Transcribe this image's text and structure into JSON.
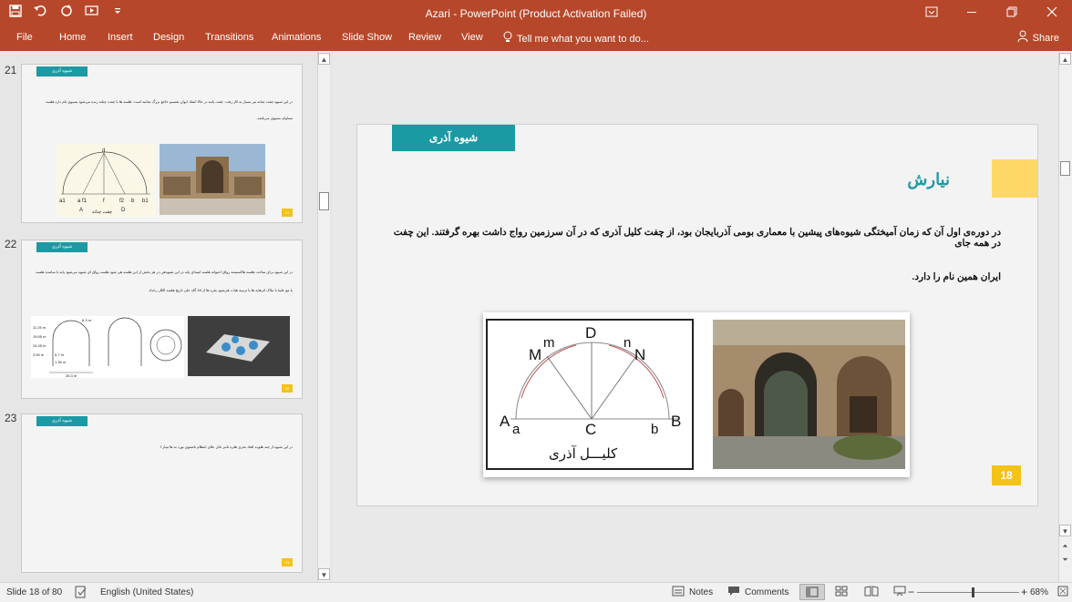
{
  "app": {
    "title": "Azari - PowerPoint (Product Activation Failed)",
    "accent": "#b7472a"
  },
  "qat": [
    "save-icon",
    "undo-icon",
    "redo-icon",
    "from-beginning-icon",
    "customize-icon"
  ],
  "window_controls": [
    "ribbon-display-icon",
    "minimize-icon",
    "maximize-icon",
    "close-icon"
  ],
  "ribbon": {
    "tabs": [
      "File",
      "Home",
      "Insert",
      "Design",
      "Transitions",
      "Animations",
      "Slide Show",
      "Review",
      "View"
    ],
    "tell_me": "Tell me what you want to do...",
    "share": "Share"
  },
  "thumbnails": [
    {
      "number": "21",
      "tag": "شیوه آذری",
      "page": "21",
      "lines": [
        "در این شیوه چفت چناته نیز بسیار به کار رفت. چفت پاتبه در حالا انتقاد ایوان تقسیم حاجع بزرگ چناتبه است. هلسه ها با چفت چناته زنده می‌شود بسیوی نام دارد هلسه",
        "ستاواید بسیوی می‌باشد."
      ],
      "arch_labels": [
        "a1",
        "a f1",
        "f",
        "f2",
        "b",
        "b1",
        "A",
        "D",
        "d"
      ],
      "arch_caption": "چفت چناته"
    },
    {
      "number": "22",
      "tag": "شیوه آذری",
      "page": "22",
      "lines": [
        "در این شیوه برای ساخت هلسه هاکسسته رواق اعیوانه هلسه ابتیه‌ای پایه در این شیوه‌هی در هر بخش از این هلسه هی شود هلسه رواق ای شیوه می‌شود پایه با ساتنده هلسه",
        "یا مع علما با ملاک اثرهایه ها با ترتیبه هیات هی‌شود بقره ها از 18 گاه علی تاریخ هلسه الکار رخداد"
      ],
      "drawing_labels": [
        "6.3 m",
        "11.25 m",
        "19.65 m",
        "24.45 m",
        "26.3 m",
        "5.7 m",
        "1.35 m",
        "3.90 m"
      ]
    },
    {
      "number": "23",
      "tag": "شیوه آذری",
      "page": "23",
      "lines": [
        "در این شیوه از چند هلوده افتاد بخری هلره ناتبر ناتل علای انتظام ناشتوی نورد به ها تیباز ا"
      ]
    }
  ],
  "slide": {
    "header": "شیوه آذری",
    "section_title": "نیارش",
    "body_line1": "در دوره‌ی اول آن که زمان آمیختگی شیوه‌های پیشین با معماری بومی آذربایجان بود، از چفت کلیل آذری که در آن سرزمین رواج داشت بهره گرفتند. این چفت در همه جای",
    "body_line2": "ایران همین نام را دارد.",
    "page_number": "18",
    "arch_labels": {
      "D": "D",
      "m": "m",
      "M": "M",
      "n": "n",
      "N": "N",
      "A": "A",
      "a": "a",
      "C": "C",
      "b": "b",
      "B": "B"
    },
    "arch_caption": "کلیـــل آذری",
    "colors": {
      "teal": "#1b9aa4",
      "yellow": "#fdd866",
      "orange": "#f3c317"
    }
  },
  "status": {
    "slide": "Slide 18 of 80",
    "language": "English (United States)",
    "notes": "Notes",
    "comments": "Comments",
    "zoom": "68%",
    "zoom_level": 68
  }
}
